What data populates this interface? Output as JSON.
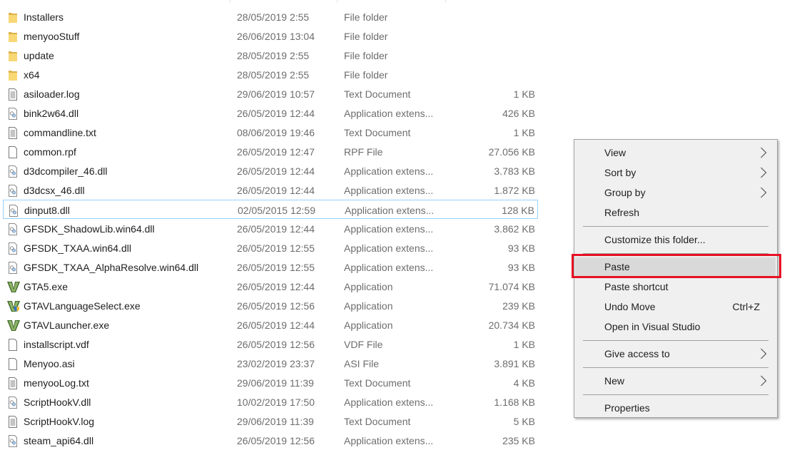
{
  "files": [
    {
      "name": "Installers",
      "date": "28/05/2019 2:55",
      "type": "File folder",
      "size": "",
      "icon": "folder-icon"
    },
    {
      "name": "menyooStuff",
      "date": "26/06/2019 13:04",
      "type": "File folder",
      "size": "",
      "icon": "folder-icon"
    },
    {
      "name": "update",
      "date": "28/05/2019 2:55",
      "type": "File folder",
      "size": "",
      "icon": "folder-icon"
    },
    {
      "name": "x64",
      "date": "28/05/2019 2:55",
      "type": "File folder",
      "size": "",
      "icon": "folder-icon"
    },
    {
      "name": "asiloader.log",
      "date": "29/06/2019 10:57",
      "type": "Text Document",
      "size": "1 KB",
      "icon": "text-file-icon"
    },
    {
      "name": "bink2w64.dll",
      "date": "26/05/2019 12:44",
      "type": "Application extens...",
      "size": "426 KB",
      "icon": "dll-file-icon"
    },
    {
      "name": "commandline.txt",
      "date": "08/06/2019 19:46",
      "type": "Text Document",
      "size": "1 KB",
      "icon": "text-file-icon"
    },
    {
      "name": "common.rpf",
      "date": "26/05/2019 12:47",
      "type": "RPF File",
      "size": "27.056 KB",
      "icon": "blank-file-icon"
    },
    {
      "name": "d3dcompiler_46.dll",
      "date": "26/05/2019 12:44",
      "type": "Application extens...",
      "size": "3.783 KB",
      "icon": "dll-file-icon"
    },
    {
      "name": "d3dcsx_46.dll",
      "date": "26/05/2019 12:44",
      "type": "Application extens...",
      "size": "1.872 KB",
      "icon": "dll-file-icon"
    },
    {
      "name": "dinput8.dll",
      "date": "02/05/2015 12:59",
      "type": "Application extens...",
      "size": "128 KB",
      "icon": "dll-file-icon",
      "selected": true
    },
    {
      "name": "GFSDK_ShadowLib.win64.dll",
      "date": "26/05/2019 12:44",
      "type": "Application extens...",
      "size": "3.862 KB",
      "icon": "dll-file-icon"
    },
    {
      "name": "GFSDK_TXAA.win64.dll",
      "date": "26/05/2019 12:55",
      "type": "Application extens...",
      "size": "93 KB",
      "icon": "dll-file-icon"
    },
    {
      "name": "GFSDK_TXAA_AlphaResolve.win64.dll",
      "date": "26/05/2019 12:55",
      "type": "Application extens...",
      "size": "93 KB",
      "icon": "dll-file-icon"
    },
    {
      "name": "GTA5.exe",
      "date": "26/05/2019 12:44",
      "type": "Application",
      "size": "71.074 KB",
      "icon": "gta-v-icon"
    },
    {
      "name": "GTAVLanguageSelect.exe",
      "date": "26/05/2019 12:56",
      "type": "Application",
      "size": "239 KB",
      "icon": "gta-v-shield-icon"
    },
    {
      "name": "GTAVLauncher.exe",
      "date": "26/05/2019 12:44",
      "type": "Application",
      "size": "20.734 KB",
      "icon": "gta-v-icon"
    },
    {
      "name": "installscript.vdf",
      "date": "26/05/2019 12:56",
      "type": "VDF File",
      "size": "1 KB",
      "icon": "blank-file-icon"
    },
    {
      "name": "Menyoo.asi",
      "date": "23/02/2019 23:37",
      "type": "ASI File",
      "size": "3.891 KB",
      "icon": "blank-file-icon"
    },
    {
      "name": "menyooLog.txt",
      "date": "29/06/2019 11:39",
      "type": "Text Document",
      "size": "4 KB",
      "icon": "text-file-icon"
    },
    {
      "name": "ScriptHookV.dll",
      "date": "10/02/2019 17:50",
      "type": "Application extens...",
      "size": "1.168 KB",
      "icon": "dll-file-icon"
    },
    {
      "name": "ScriptHookV.log",
      "date": "29/06/2019 11:39",
      "type": "Text Document",
      "size": "5 KB",
      "icon": "text-file-icon"
    },
    {
      "name": "steam_api64.dll",
      "date": "26/05/2019 12:56",
      "type": "Application extens...",
      "size": "235 KB",
      "icon": "dll-file-icon"
    }
  ],
  "context_menu": {
    "items": [
      {
        "label": "View",
        "submenu": true
      },
      {
        "label": "Sort by",
        "submenu": true
      },
      {
        "label": "Group by",
        "submenu": true
      },
      {
        "label": "Refresh"
      },
      {
        "separator": true
      },
      {
        "label": "Customize this folder..."
      },
      {
        "separator": true
      },
      {
        "label": "Paste",
        "highlighted": true
      },
      {
        "label": "Paste shortcut"
      },
      {
        "label": "Undo Move",
        "shortcut": "Ctrl+Z"
      },
      {
        "label": "Open in Visual Studio"
      },
      {
        "separator": true
      },
      {
        "label": "Give access to",
        "submenu": true
      },
      {
        "separator": true
      },
      {
        "label": "New",
        "submenu": true
      },
      {
        "separator": true
      },
      {
        "label": "Properties"
      }
    ]
  },
  "colors": {
    "highlight_box": "#e81123",
    "selection_border": "#99d1ff",
    "menu_bg": "#f0f0f0"
  }
}
